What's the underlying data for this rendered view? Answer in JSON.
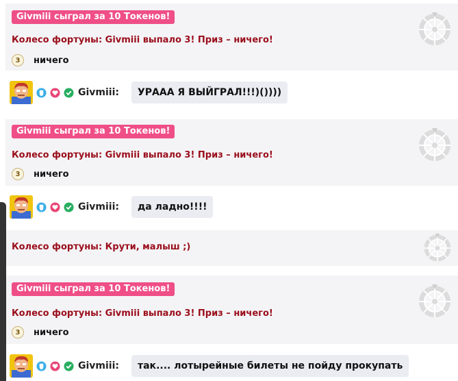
{
  "token_badge": "Givmiii сыграл за 10 Токенов!",
  "wheel_result": "Колесо фортуны: Givmiii выпало 3! Приз – ничего!",
  "prize_number": "3",
  "prize_text": "ничего",
  "username": "Givmiii:",
  "wheel_spin_text": "Колесо фортуны: Крути, малыш ;)",
  "messages": [
    "УРААА Я ВЫЙГРАЛ!!!)())))",
    "да ладно!!!!",
    "так.... лотырейные билеты не пойду прокупать"
  ],
  "colors": {
    "badge": "#ef4f86",
    "wheel_text": "#9a0d1b",
    "block_bg": "#f4f4f6",
    "bubble_bg": "#eaecf2"
  },
  "icons": [
    "avatar",
    "shield-icon",
    "heart-icon",
    "check-icon",
    "wheel-of-fortune-icon"
  ]
}
